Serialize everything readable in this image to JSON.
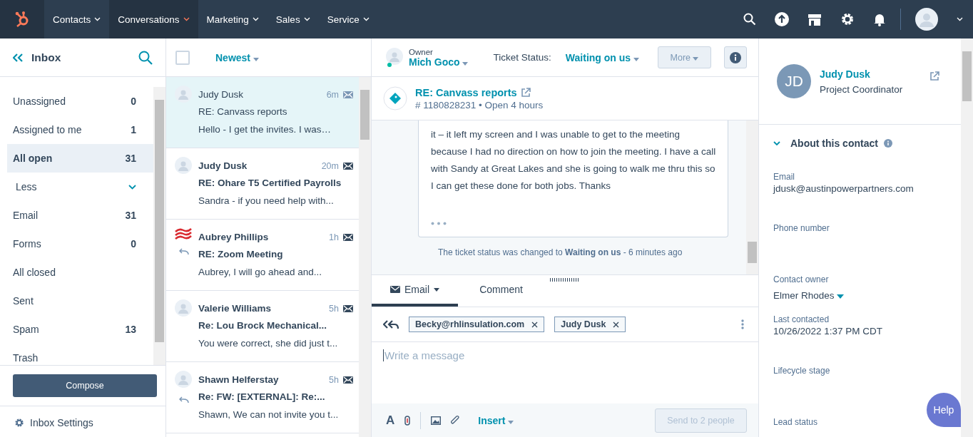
{
  "nav": {
    "items": [
      {
        "label": "Contacts",
        "selected": false
      },
      {
        "label": "Conversations",
        "selected": true
      },
      {
        "label": "Marketing",
        "selected": false
      },
      {
        "label": "Sales",
        "selected": false
      },
      {
        "label": "Service",
        "selected": false
      }
    ]
  },
  "sidebar": {
    "title": "Inbox",
    "items": [
      {
        "label": "Unassigned",
        "count": "0",
        "selected": false,
        "kind": "item"
      },
      {
        "label": "Assigned to me",
        "count": "1",
        "selected": false,
        "kind": "item"
      },
      {
        "label": "All open",
        "count": "31",
        "selected": true,
        "kind": "item"
      },
      {
        "label": "Less",
        "selected": false,
        "kind": "toggle",
        "expanded": true
      },
      {
        "label": "Email",
        "count": "31",
        "selected": false,
        "kind": "item"
      },
      {
        "label": "Forms",
        "count": "0",
        "selected": false,
        "kind": "item"
      },
      {
        "label": "All closed",
        "selected": false,
        "kind": "item"
      },
      {
        "label": "Sent",
        "selected": false,
        "kind": "item"
      },
      {
        "label": "Spam",
        "count": "13",
        "selected": false,
        "kind": "item"
      },
      {
        "label": "Trash",
        "selected": false,
        "kind": "item"
      }
    ],
    "compose": "Compose",
    "settings": "Inbox Settings"
  },
  "list": {
    "select_all": {
      "checked": false
    },
    "sort": "Newest",
    "threads": [
      {
        "name": "Judy Dusk",
        "time": "6m",
        "subject": "RE: Canvass reports",
        "preview": "Hello - I get the invites. I was…",
        "selected": true,
        "unread": false,
        "kind": "person",
        "replied": false
      },
      {
        "name": "Judy Dusk",
        "time": "20m",
        "subject": "RE: Ohare T5 Certified Payrolls",
        "preview": "Sandra - if you need help with...",
        "selected": false,
        "unread": true,
        "kind": "person",
        "replied": false
      },
      {
        "name": "Aubrey Phillips",
        "time": "1h",
        "subject": "RE: Zoom Meeting",
        "preview": "Aubrey, I will go ahead and...",
        "selected": false,
        "unread": true,
        "kind": "logo",
        "replied": true
      },
      {
        "name": "Valerie Williams",
        "time": "5h",
        "subject": "Re: Lou Brock Mechanical...",
        "preview": "You were correct, she did just t...",
        "selected": false,
        "unread": true,
        "kind": "person",
        "replied": false
      },
      {
        "name": "Shawn Helferstay",
        "time": "5h",
        "subject": "Re: FW: [EXTERNAL]: Re:...",
        "preview": "Shawn, We can not invite you t...",
        "selected": false,
        "unread": true,
        "kind": "person",
        "replied": true
      }
    ]
  },
  "ticket": {
    "owner_label": "Owner",
    "owner": "Mich Goco",
    "status_label": "Ticket Status:",
    "status": "Waiting on us",
    "more": "More",
    "title": "RE: Canvass reports",
    "meta": "# 1180828231 • Open 4 hours",
    "message": "it – it left my screen and I was unable to get to the meeting because I had no direction on how to join the meeting. I have a call with Sandy at Great Lakes and she is going to walk me thru this so I can get these done for both jobs. Thanks",
    "status_note": "The ticket status was changed to **Waiting on us** - 6 minutes ago"
  },
  "composer": {
    "tabs": [
      {
        "label": "Email",
        "selected": true
      },
      {
        "label": "Comment",
        "selected": false
      }
    ],
    "recipients": [
      "Becky@rhlinsulation.com",
      "Judy Dusk"
    ],
    "placeholder": "Write a message",
    "format": "A",
    "insert": "Insert",
    "send": "Send to 2 people"
  },
  "contact": {
    "initials": "JD",
    "name": "Judy Dusk",
    "role": "Project Coordinator",
    "section": "About this contact",
    "expanded": true,
    "fields": [
      {
        "label": "Email",
        "value": "jdusk@austinpowerpartners.com",
        "kind": "text"
      },
      {
        "label": "Phone number",
        "kind": "text"
      },
      {
        "label": "Contact owner",
        "value": "Elmer Rhodes",
        "kind": "select"
      },
      {
        "label": "Last contacted",
        "value": "10/26/2022 1:37 PM CDT",
        "kind": "text"
      },
      {
        "label": "Lifecycle stage",
        "kind": "text"
      },
      {
        "label": "Lead status",
        "kind": "text"
      }
    ]
  },
  "help": "Help"
}
